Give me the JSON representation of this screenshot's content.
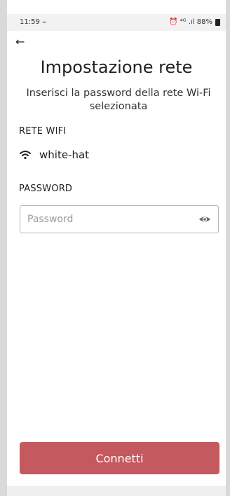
{
  "status_bar": {
    "time": "11:59 ⌣",
    "indicators": "⏰ ⁴ᴳ .ıl 88%"
  },
  "header": {
    "back_icon": "←"
  },
  "title": "Impostazione rete",
  "subtitle": "Inserisci la password della rete Wi-Fi selezionata",
  "wifi_section": {
    "label": "RETE WIFI",
    "network_name": "white-hat",
    "icon": "wifi-icon"
  },
  "password_section": {
    "label": "PASSWORD",
    "value": "",
    "placeholder": "Password",
    "icon": "eye-icon"
  },
  "actions": {
    "connect_label": "Connetti"
  },
  "colors": {
    "accent": "#c45960",
    "text": "#1c1c1c",
    "border": "#b7b7b7"
  }
}
